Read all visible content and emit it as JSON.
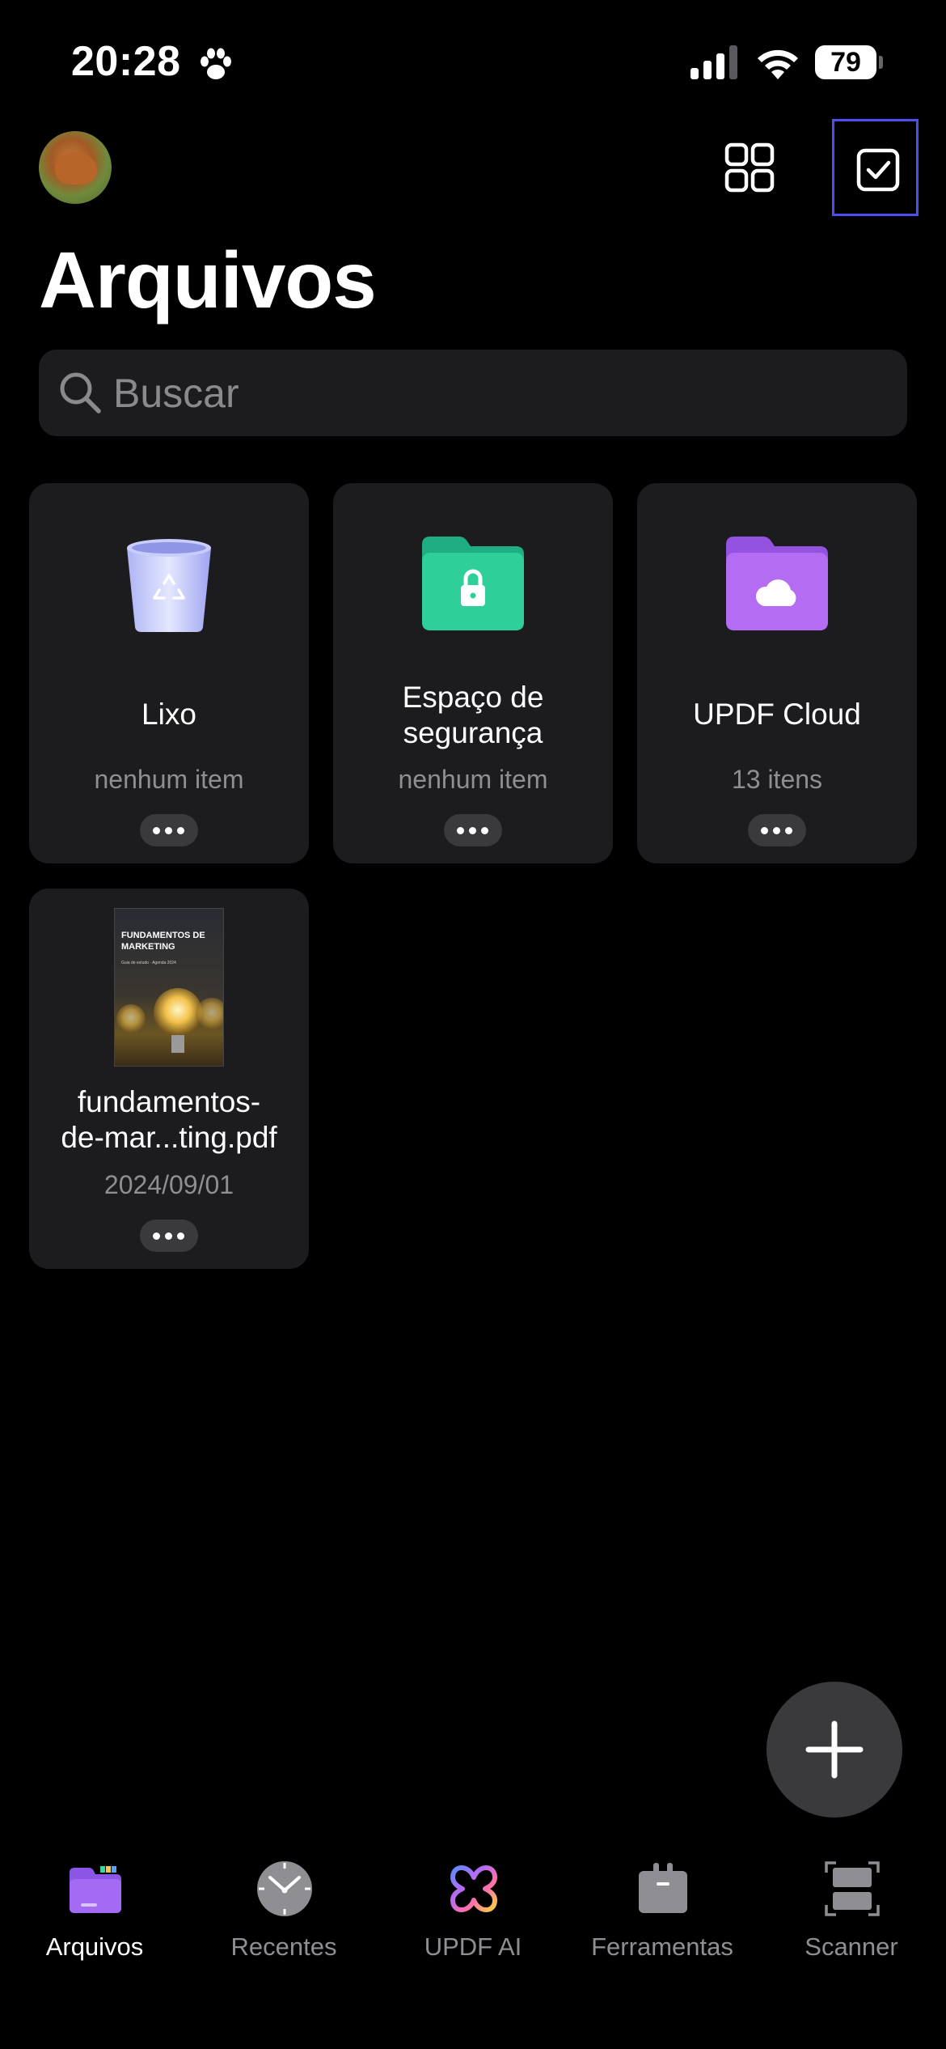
{
  "status_bar": {
    "time": "20:28",
    "battery": "79",
    "icons": [
      "paw-icon",
      "cellular-signal-icon",
      "wifi-icon",
      "battery-icon"
    ]
  },
  "header": {
    "title": "Arquivos",
    "avatar": "profile-avatar",
    "grid_view_icon": "grid-view-icon",
    "select_icon": "checkbox-select-icon"
  },
  "search": {
    "placeholder": "Buscar",
    "icon": "search-icon"
  },
  "items": [
    {
      "name": "Lixo",
      "subtitle": "nenhum item",
      "icon": "trash-bin-icon"
    },
    {
      "name_line1": "Espaço de",
      "name_line2": "segurança",
      "subtitle": "nenhum item",
      "icon": "lock-folder-icon",
      "color": "#2fcf9a"
    },
    {
      "name": "UPDF Cloud",
      "subtitle": "13 itens",
      "icon": "cloud-folder-icon",
      "color": "#b36cf2"
    },
    {
      "name_line1": "fundamentos-",
      "name_line2": "de-mar...ting.pdf",
      "subtitle": "2024/09/01",
      "icon": "pdf-thumbnail",
      "thumb_title": "FUNDAMENTOS DE MARKETING",
      "thumb_subtitle": "Guia de estudo · Agenda 2024"
    }
  ],
  "fab": {
    "icon": "plus-icon"
  },
  "tabs": [
    {
      "label": "Arquivos",
      "icon": "folder-icon",
      "active": true,
      "color": "#a56af3"
    },
    {
      "label": "Recentes",
      "icon": "clock-icon",
      "active": false
    },
    {
      "label": "UPDF AI",
      "icon": "updf-ai-icon",
      "active": false
    },
    {
      "label": "Ferramentas",
      "icon": "toolbox-icon",
      "active": false
    },
    {
      "label": "Scanner",
      "icon": "scanner-icon",
      "active": false
    }
  ]
}
